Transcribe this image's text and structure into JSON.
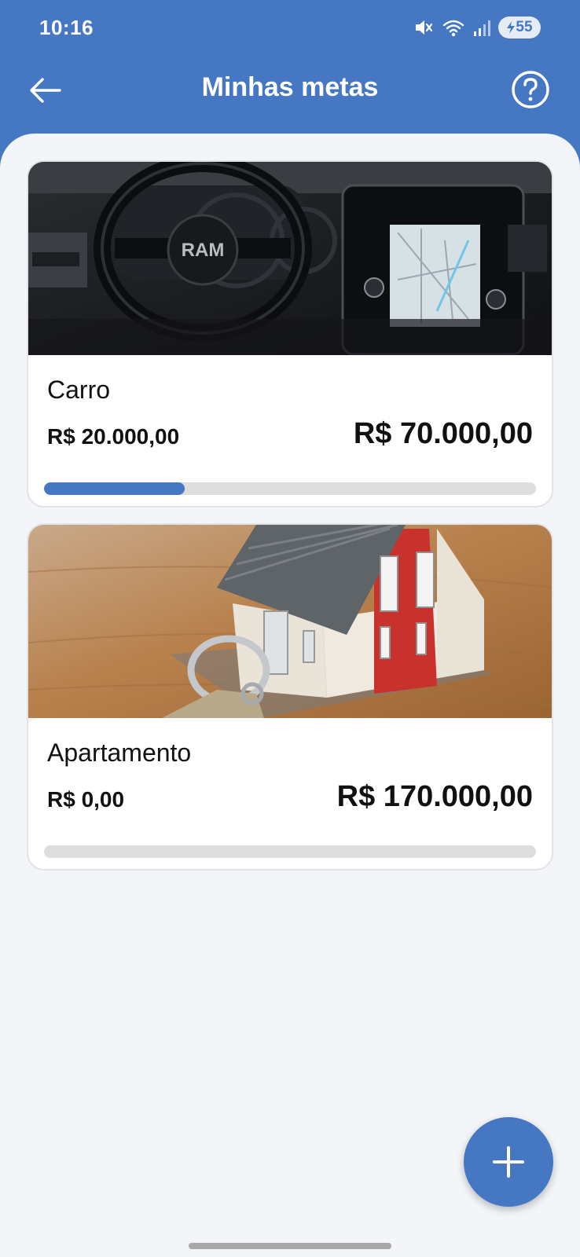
{
  "status_bar": {
    "time": "10:16",
    "battery": "55",
    "icons": [
      "mute-icon",
      "wifi-icon",
      "signal-icon",
      "battery-charging-icon"
    ]
  },
  "app_bar": {
    "title": "Minhas metas",
    "back_icon": "arrow-left-icon",
    "help_icon": "question-circle-icon"
  },
  "goals": [
    {
      "name": "Carro",
      "current": "R$ 20.000,00",
      "target": "R$ 70.000,00",
      "progress": 0.2857,
      "image": "car-interior-photo"
    },
    {
      "name": "Apartamento",
      "current": "R$ 0,00",
      "target": "R$ 170.000,00",
      "progress": 0,
      "image": "house-keys-photo"
    }
  ],
  "fab": {
    "icon": "plus-icon"
  },
  "colors": {
    "primary": "#4677c2",
    "background": "#f3f5f8",
    "track": "#dedede"
  }
}
